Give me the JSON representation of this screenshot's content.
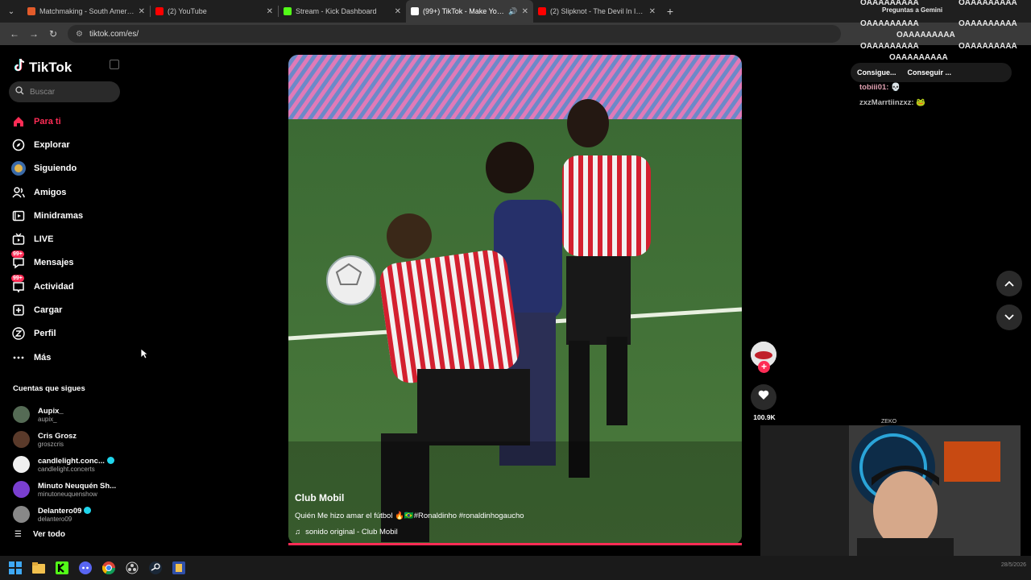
{
  "browser": {
    "tabs": [
      {
        "title": "Matchmaking - South America",
        "color": "#e35b2a",
        "active": false
      },
      {
        "title": "(2) YouTube",
        "color": "#ff0000",
        "active": false
      },
      {
        "title": "Stream - Kick Dashboard",
        "color": "#53fc18",
        "active": false
      },
      {
        "title": "(99+) TikTok - Make Your Da",
        "color": "#ffffff",
        "active": true
      },
      {
        "title": "(2) Slipknot - The Devil In I [OFF",
        "color": "#ff0000",
        "active": false
      }
    ],
    "url": "tiktok.com/es/"
  },
  "sidebar": {
    "brand": "TikTok",
    "search_placeholder": "Buscar",
    "nav": [
      {
        "label": "Para ti",
        "icon": "home-icon",
        "active": true
      },
      {
        "label": "Explorar",
        "icon": "compass-icon"
      },
      {
        "label": "Siguiendo",
        "icon": "following-avatar-icon"
      },
      {
        "label": "Amigos",
        "icon": "friends-icon"
      },
      {
        "label": "Minidramas",
        "icon": "film-icon"
      },
      {
        "label": "LIVE",
        "icon": "live-tv-icon"
      },
      {
        "label": "Mensajes",
        "icon": "messages-icon",
        "badge": "99+"
      },
      {
        "label": "Actividad",
        "icon": "activity-icon",
        "badge": "99+"
      },
      {
        "label": "Cargar",
        "icon": "upload-icon"
      },
      {
        "label": "Perfil",
        "icon": "profile-icon"
      },
      {
        "label": "Más",
        "icon": "more-icon"
      }
    ],
    "follows_title": "Cuentas que sigues",
    "follows": [
      {
        "name": "Aupix_",
        "handle": "aupix_",
        "color": "#556b55",
        "verified": false
      },
      {
        "name": "Cris Grosz",
        "handle": "groszcris",
        "color": "#5a3a2a",
        "verified": false
      },
      {
        "name": "candlelight.conc...",
        "handle": "candlelight.concerts",
        "color": "#f0f0f0",
        "verified": true
      },
      {
        "name": "Minuto Neuquén Sh...",
        "handle": "minutoneuquenshow",
        "color": "#7a3fd0",
        "verified": false
      },
      {
        "name": "Delantero09",
        "handle": "delantero09",
        "color": "#888888",
        "verified": true
      }
    ],
    "see_all": "Ver todo"
  },
  "video": {
    "author": "Club Mobil",
    "description": "Quién Me hizo amar el fútbol 🔥🇧🇷#Ronaldinho #ronaldinhogaucho",
    "sound": "sonido original - Club Mobil",
    "likes": "100.9K"
  },
  "chat": {
    "spam_text": "OAAAAAAAAA",
    "overlay_title": "Preguntas a Gemini",
    "bar_left": "Consigue...",
    "bar_right": "Conseguir ...",
    "lines": [
      {
        "user": "tobiii01:",
        "msg": "💀"
      },
      {
        "user": "zxzMarrtiinzxz:",
        "msg": "🐸"
      }
    ]
  },
  "stream": {
    "cam_label": "ZEKO"
  },
  "taskbar": {
    "clock": "28/5/2026"
  }
}
